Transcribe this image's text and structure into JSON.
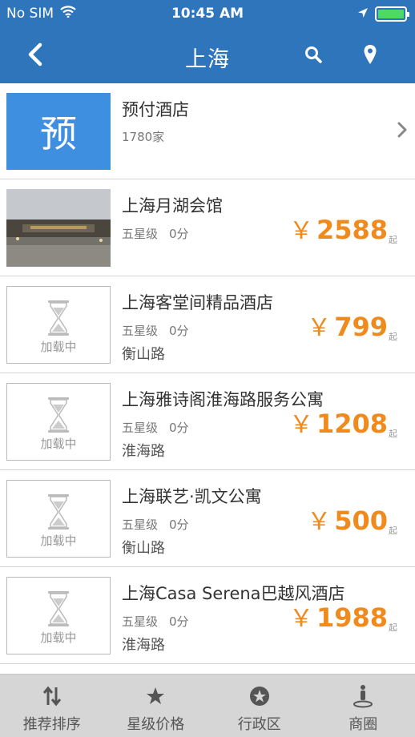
{
  "status_bar": {
    "carrier": "No SIM",
    "time": "10:45 AM"
  },
  "nav": {
    "title": "上海",
    "icons": [
      "chevron-left-icon",
      "search-icon",
      "location-pin-icon"
    ]
  },
  "prepaid": {
    "badge": "预",
    "title": "预付酒店",
    "count": "1780家"
  },
  "hotels": [
    {
      "name": "上海月湖会馆",
      "stars": "五星级",
      "score": "0分",
      "area": "",
      "price": "2588",
      "currency": "￥",
      "suffix": "起",
      "thumb": "photo"
    },
    {
      "name": "上海客堂间精品酒店",
      "stars": "五星级",
      "score": "0分",
      "area": "衡山路",
      "price": "799",
      "currency": "￥",
      "suffix": "起",
      "thumb": "loading",
      "loading_text": "加载中"
    },
    {
      "name": "上海雅诗阁淮海路服务公寓",
      "stars": "五星级",
      "score": "0分",
      "area": "淮海路",
      "price": "1208",
      "currency": "￥",
      "suffix": "起",
      "thumb": "loading",
      "loading_text": "加载中"
    },
    {
      "name": "上海联艺·凯文公寓",
      "stars": "五星级",
      "score": "0分",
      "area": "衡山路",
      "price": "500",
      "currency": "￥",
      "suffix": "起",
      "thumb": "loading",
      "loading_text": "加载中"
    },
    {
      "name": "上海Casa Serena巴越风酒店",
      "stars": "五星级",
      "score": "0分",
      "area": "淮海路",
      "price": "1988",
      "currency": "￥",
      "suffix": "起",
      "thumb": "loading",
      "loading_text": "加载中"
    }
  ],
  "tabs": [
    {
      "label": "推荐排序",
      "icon": "sort-arrows-icon"
    },
    {
      "label": "星级价格",
      "icon": "star-icon"
    },
    {
      "label": "行政区",
      "icon": "district-star-icon"
    },
    {
      "label": "商圈",
      "icon": "pin-person-icon"
    }
  ],
  "colors": {
    "nav_background": "#2f75bb",
    "prepaid_badge": "#3e8fe0",
    "price": "#f08a1c",
    "tab_bar": "#d6d6d6",
    "battery": "#4cd964"
  }
}
